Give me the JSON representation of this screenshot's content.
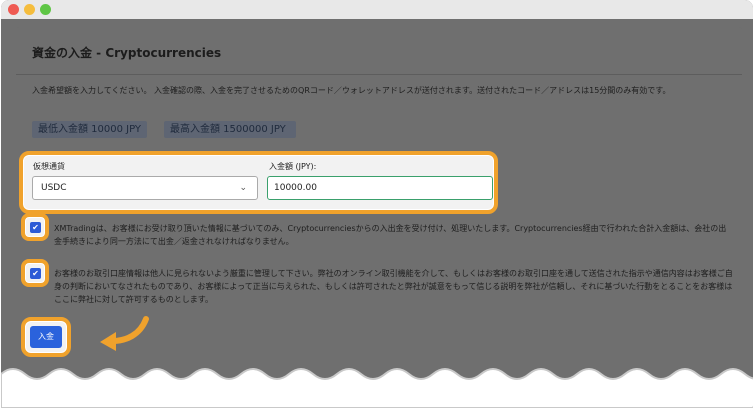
{
  "page": {
    "title": "資金の入金 - Cryptocurrencies",
    "intro": "入金希望額を入力してください。 入金確認の際、入金を完了させるためのQRコード／ウォレットアドレスが送付されます。送付されたコード／アドレスは15分間のみ有効です。"
  },
  "limits": {
    "min": "最低入金額 10000 JPY",
    "max": "最高入金額 1500000 JPY"
  },
  "form": {
    "currency_label": "仮想通貨",
    "currency_value": "USDC",
    "amount_label": "入金額 (JPY):",
    "amount_value": "10000.00"
  },
  "terms": {
    "first": "XMTradingは、お客様にお受け取り頂いた情報に基づいてのみ、Cryptocurrenciesからの入出金を受け付け、処理いたします。Cryptocurrencies経由で行われた合計入金額は、会社の出金手続きにより同一方法にて出金／返金されなければなりません。",
    "second": "お客様のお取引口座情報は他人に見られないよう厳重に管理して下さい。弊社のオンライン取引機能を介して、もしくはお客様のお取引口座を通して送信された指示や通信内容はお客様ご自身の判断においてなされたものであり、お客様によって正当に与えられた、もしくは許可されたと弊社が誠意をもって信じる説明を弊社が信頼し、それに基づいた行動をとることをお客様はここに弊社に対して許可するものとします。"
  },
  "actions": {
    "deposit_label": "入金"
  },
  "icons": {
    "checkmark": "✔",
    "chevron": "⌄"
  },
  "colors": {
    "highlight": "#f0a22c",
    "primary_button": "#2a62dc"
  }
}
